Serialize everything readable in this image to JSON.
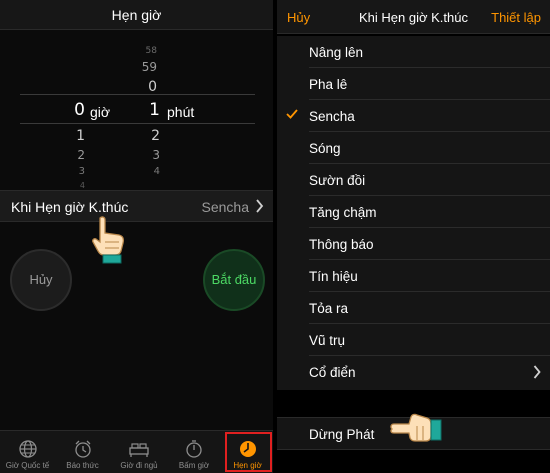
{
  "timer_screen": {
    "title": "Hẹn giờ",
    "picker": {
      "hours_above": [
        "58",
        "59",
        "0"
      ],
      "hours_below": [
        "1",
        "2",
        "3",
        "4"
      ],
      "selected_hours": "0",
      "hour_unit": "giờ",
      "minutes_above": [],
      "minutes_below": [
        "2",
        "3",
        "4"
      ],
      "selected_minutes": "1",
      "minute_unit": "phút"
    },
    "when_timer_ends": {
      "label": "Khi Hẹn giờ K.thúc",
      "value": "Sencha"
    },
    "cancel_label": "Hủy",
    "start_label": "Bắt đầu",
    "tabs": [
      {
        "label": "Giờ Quốc tế",
        "icon": "globe-icon"
      },
      {
        "label": "Báo thức",
        "icon": "alarm-clock-icon"
      },
      {
        "label": "Giờ đi ngủ",
        "icon": "bed-icon"
      },
      {
        "label": "Bấm giờ",
        "icon": "stopwatch-icon"
      },
      {
        "label": "Hẹn giờ",
        "icon": "timer-icon"
      }
    ],
    "active_tab": "Hẹn giờ"
  },
  "tone_screen": {
    "cancel_label": "Hủy",
    "title": "Khi Hẹn giờ K.thúc",
    "set_label": "Thiết lập",
    "tones": [
      "Nâng lên",
      "Pha lê",
      "Sencha",
      "Sóng",
      "Sườn đồi",
      "Tăng chậm",
      "Thông báo",
      "Tín hiệu",
      "Tỏa ra",
      "Vũ trụ",
      "Cổ điển"
    ],
    "selected_tone": "Sencha",
    "stop_playing_label": "Dừng Phát"
  },
  "colors": {
    "accent": "#ff9500",
    "start_green": "#4cd964",
    "highlight_red": "#e02020"
  }
}
